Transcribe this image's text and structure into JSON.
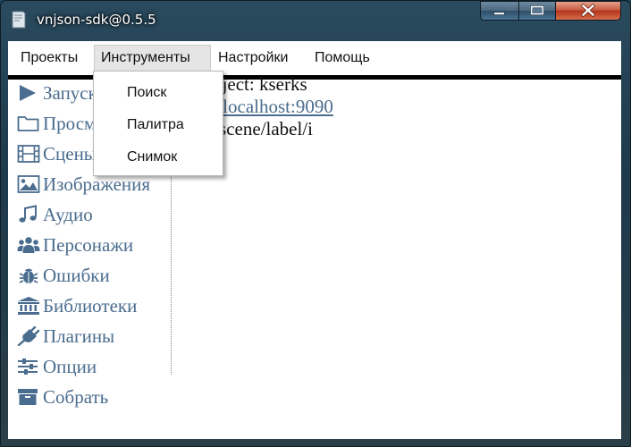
{
  "window": {
    "title": "vnjson-sdk@0.5.5"
  },
  "menubar": {
    "items": [
      {
        "label": "Проекты"
      },
      {
        "label": "Инструменты"
      },
      {
        "label": "Настройки"
      },
      {
        "label": "Помощь"
      }
    ]
  },
  "dropdown": {
    "items": [
      {
        "label": "Поиск"
      },
      {
        "label": "Палитра"
      },
      {
        "label": "Снимок"
      }
    ]
  },
  "sidebar": {
    "items": [
      {
        "label": "Запуск",
        "icon": "play-icon"
      },
      {
        "label": "Просмотр",
        "icon": "folder-icon"
      },
      {
        "label": "Сцены",
        "icon": "film-icon"
      },
      {
        "label": "Изображения",
        "icon": "image-icon"
      },
      {
        "label": "Аудио",
        "icon": "music-icon"
      },
      {
        "label": "Персонажи",
        "icon": "users-icon"
      },
      {
        "label": "Ошибки",
        "icon": "bug-icon"
      },
      {
        "label": "Библиотеки",
        "icon": "library-icon"
      },
      {
        "label": "Плагины",
        "icon": "plug-icon"
      },
      {
        "label": "Опции",
        "icon": "sliders-icon"
      },
      {
        "label": "Собрать",
        "icon": "archive-icon"
      }
    ]
  },
  "content": {
    "line1": "nt project: kserks",
    "line2": "http://localhost:9090",
    "line3": "ame: scene/label/i"
  },
  "colors": {
    "accent": "#4a6c8e",
    "close_button": "#c75d42"
  }
}
